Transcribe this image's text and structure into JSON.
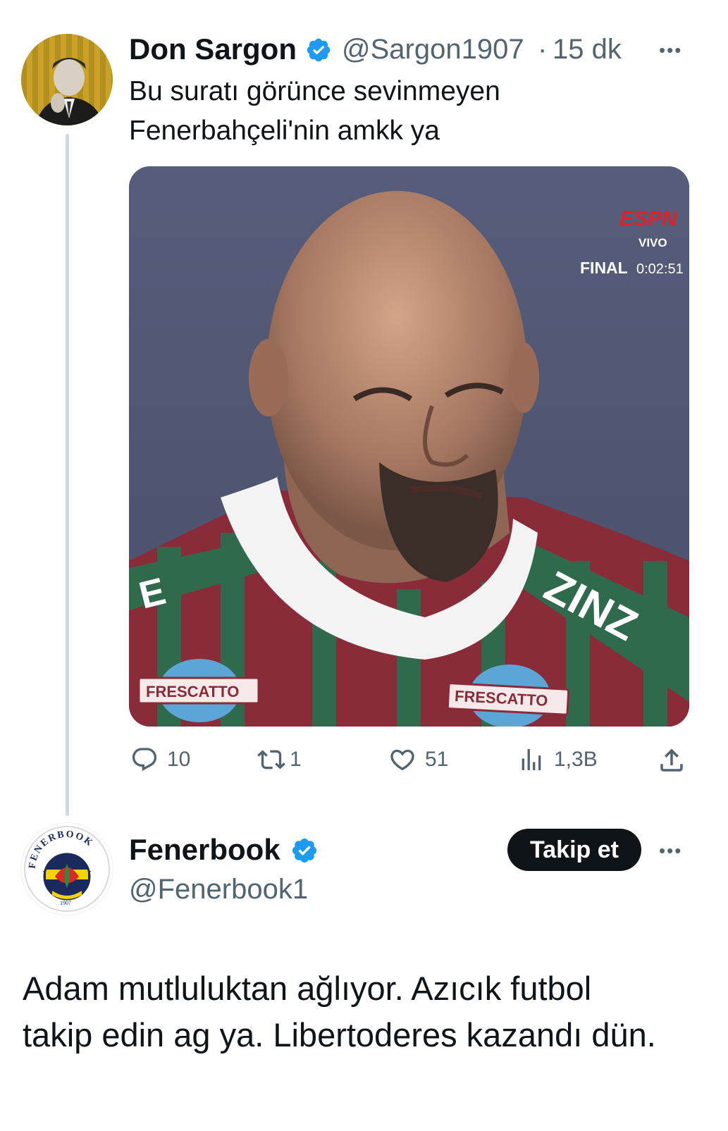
{
  "tweet": {
    "author_name": "Don Sargon",
    "author_handle": "@Sargon1907",
    "separator": "·",
    "time": "15 dk",
    "text_line1": "Bu suratı görünce sevinmeyen",
    "text_line2": "Fenerbahçeli'nin amkk ya",
    "more_label": "•••",
    "media": {
      "broadcaster": "ESPN",
      "live": "VIVO",
      "final_label": "FINAL",
      "clock": "0:02:51",
      "sponsor_left": "FRESCATTO",
      "sponsor_right": "FRESCATTO",
      "shirt_text_left": "E",
      "shirt_text_right": "ZINZ"
    },
    "actions": {
      "replies": "10",
      "retweets": "1",
      "likes": "51",
      "views": "1,3B"
    }
  },
  "reply": {
    "author_name": "Fenerbook",
    "author_handle": "@Fenerbook1",
    "follow_label": "Takip et",
    "more_label": "•••",
    "logo_text": "FENERBOOK",
    "logo_year": "1907",
    "text_line1": "Adam mutluluktan ağlıyor. Azıcık futbol",
    "text_line2": "takip edin ag ya. Libertoderes kazandı dün."
  },
  "colors": {
    "verified": "#1d9bf0",
    "text": "#0f1419",
    "secondary": "#536471",
    "thread_line": "#cfd9de"
  }
}
